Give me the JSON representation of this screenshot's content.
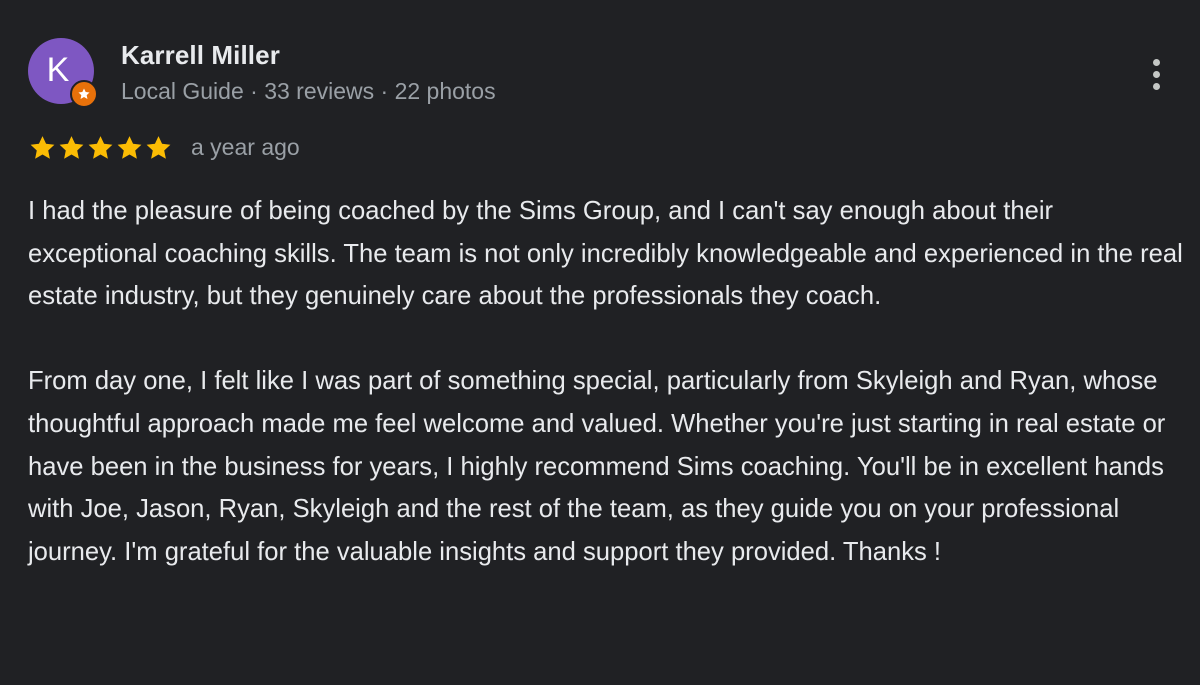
{
  "reviewer": {
    "avatar_initial": "K",
    "avatar_color": "#7e57c2",
    "badge_color": "#e8710a",
    "badge_icon": "star-icon",
    "name": "Karrell Miller",
    "meta": "Local Guide · 33 reviews · 22 photos"
  },
  "review": {
    "rating": 5,
    "rating_max": 5,
    "star_color": "#fbbc04",
    "date": "a year ago",
    "paragraphs": [
      "I had the pleasure of being coached by the Sims Group, and I can't say enough about their exceptional coaching skills. The team is not only incredibly knowledgeable and experienced in the real estate industry, but they genuinely care about the professionals they coach.",
      "From day one, I felt like I was part of something special, particularly from Skyleigh and Ryan, whose thoughtful approach made me feel welcome and valued. Whether you're just starting in real estate or have been in the business for years, I highly recommend Sims coaching. You'll be in excellent hands with Joe, Jason, Ryan, Skyleigh and the rest of the team, as they guide you on your professional journey. I'm grateful for the valuable insights and support they provided. Thanks !"
    ]
  },
  "actions": {
    "more_icon": "more-vertical-icon"
  }
}
